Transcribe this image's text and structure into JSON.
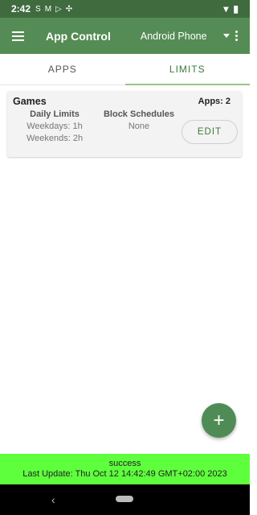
{
  "status_bar": {
    "time": "2:42",
    "icons": [
      "s-notification-icon",
      "gmail-icon",
      "play-store-icon",
      "app-shortcut-icon",
      "wifi-icon",
      "battery-icon"
    ]
  },
  "toolbar": {
    "title": "App Control",
    "device": "Android Phone"
  },
  "tabs": [
    {
      "label": "APPS"
    },
    {
      "label": "LIMITS"
    }
  ],
  "card": {
    "title": "Games",
    "apps": "Apps: 2",
    "daily_limits": {
      "header": "Daily Limits",
      "weekdays": "Weekdays: 1h",
      "weekends": "Weekends: 2h"
    },
    "block_schedules": {
      "header": "Block Schedules",
      "value": "None"
    },
    "edit_label": "EDIT"
  },
  "fab": {
    "symbol": "+"
  },
  "status_panel": {
    "status": "success",
    "last_update": "Last Update: Thu Oct 12 14:42:49 GMT+02:00 2023"
  },
  "colors": {
    "toolbar": "#558c55",
    "statusbar": "#3f6b3f",
    "accent": "#3e7a3e",
    "status_panel": "#5eff3d"
  }
}
